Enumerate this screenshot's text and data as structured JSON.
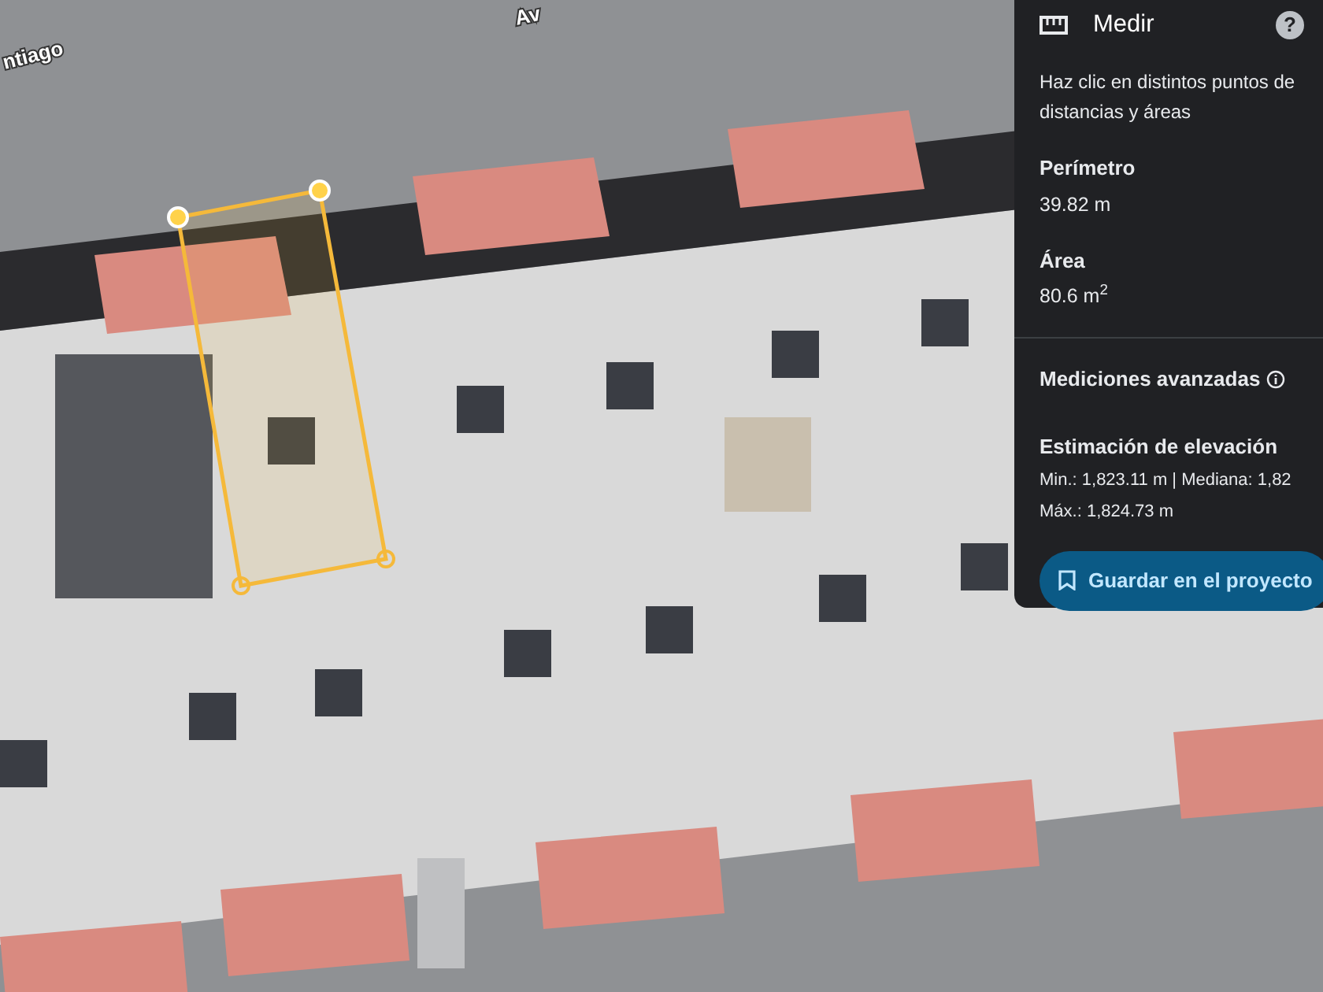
{
  "help": "?",
  "map": {
    "labels": [
      {
        "text": "ntiago",
        "kind": "street"
      },
      {
        "text": "Av",
        "kind": "street"
      }
    ],
    "measurement": {
      "closed": true
    }
  },
  "panel": {
    "title": "Medir",
    "instructions": "Haz clic en distintos puntos de\ndistancias y áreas",
    "metrics": [
      {
        "label": "Perímetro",
        "value": "39.82 m"
      },
      {
        "label": "Área",
        "value": "80.6 m$^{2}$"
      }
    ],
    "advanced": {
      "label": "Mediciones avanzadas"
    },
    "elevation": {
      "label": "Estimación de elevación",
      "lines": [
        "Min.: 1,823.11 m | Mediana: 1,82",
        "Máx.: 1,824.73 m"
      ]
    },
    "save_button": "Guardar en el proyecto"
  }
}
